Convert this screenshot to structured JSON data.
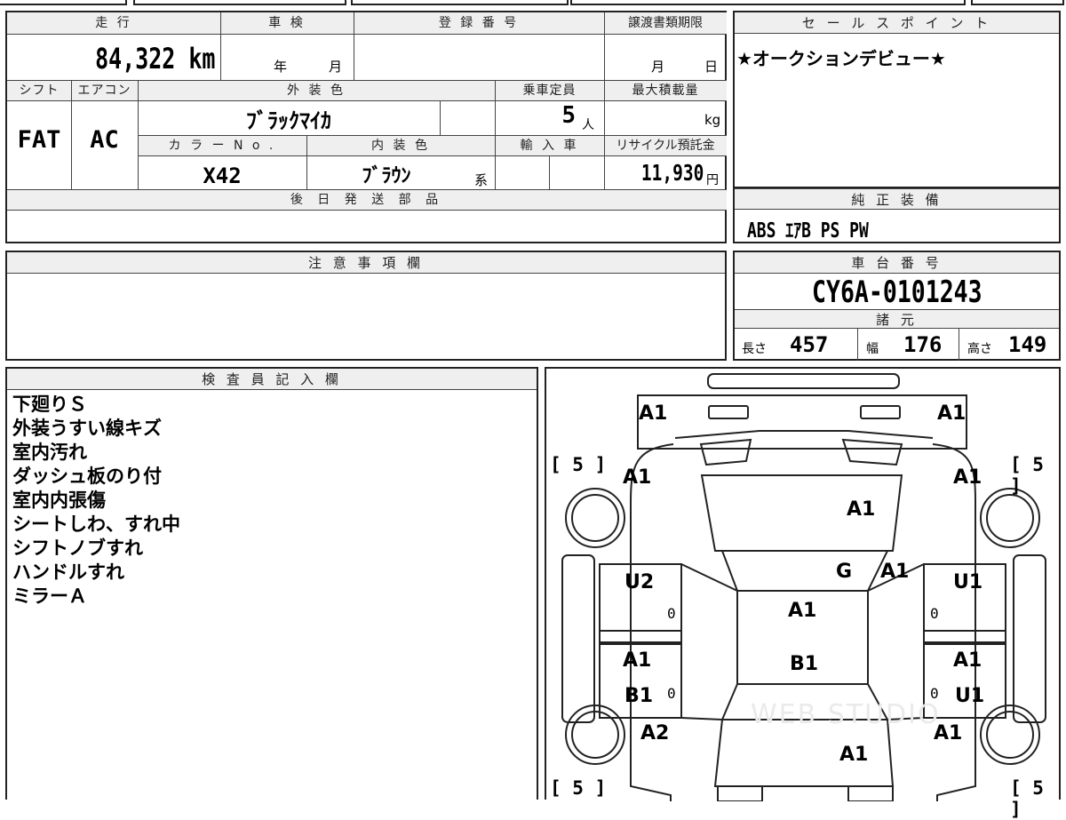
{
  "main_table": {
    "mileage_label": "走 行",
    "mileage_value": "84,322 km",
    "inspection_label": "車 検",
    "inspection_year_unit": "年",
    "inspection_month_unit": "月",
    "registration_label": "登 録 番 号",
    "transfer_label": "譲渡書類期限",
    "transfer_month_unit": "月",
    "transfer_day_unit": "日",
    "shift_label": "シフト",
    "shift_value": "FAT",
    "aircon_label": "エアコン",
    "aircon_value": "AC",
    "exterior_label": "外 装 色",
    "exterior_value": "ﾌﾞﾗｯｸﾏｲｶ",
    "capacity_label": "乗車定員",
    "capacity_value": "5",
    "capacity_unit": "人",
    "max_load_label": "最大積載量",
    "max_load_unit": "kg",
    "color_no_label": "カ ラ ー N o .",
    "color_no_value": "X42",
    "interior_label": "内 装 色",
    "interior_value": "ﾌﾞﾗｳﾝ",
    "interior_suffix": "系",
    "import_label": "輸 入 車",
    "recycle_label": "リサイクル預託金",
    "recycle_value": "11,930",
    "recycle_unit": "円",
    "later_parts_label": "後 日 発 送 部 品"
  },
  "sales_point": {
    "label": "セ ー ル ス ポ イ ン ト",
    "text": "★オークションデビュー★"
  },
  "equipment": {
    "label": "純 正 装 備",
    "text": "ABS ｴｱB PS PW"
  },
  "caution": {
    "label": "注 意 事 項 欄"
  },
  "chassis": {
    "label": "車 台 番 号",
    "value": "CY6A-0101243"
  },
  "specs": {
    "label": "諸 元",
    "length_label": "長さ",
    "length_value": "457",
    "width_label": "幅",
    "width_value": "176",
    "height_label": "高さ",
    "height_value": "149"
  },
  "inspector": {
    "label": "検 査 員 記 入 欄",
    "notes": [
      "下廻りＳ",
      "外装うすい線キズ",
      "室内汚れ",
      "ダッシュ板のり付",
      "室内内張傷",
      "シートしわ、すれ中",
      "シフトノブすれ",
      "ハンドルすれ",
      "ミラーＡ"
    ]
  },
  "diagram": {
    "marks": {
      "front_left": "A1",
      "front_right": "A1",
      "fender_left": "A1",
      "fender_right": "A1",
      "hood": "A1",
      "windshield": "G",
      "windshield_right": "A1",
      "front_door_left": "U2",
      "front_door_right": "U1",
      "roof": "A1",
      "rear_door_left_top": "A1",
      "rear_door_left_bottom": "B1",
      "roof_rear": "B1",
      "rear_door_right_top": "A1",
      "rear_door_right_bottom": "U1",
      "rear_quarter_left": "A2",
      "rear_quarter_right": "A1",
      "trunk": "A1"
    },
    "tire_top_left": "5",
    "tire_top_right": "5",
    "tire_bottom_left": "5",
    "tire_bottom_right": "5",
    "zero": "0",
    "watermark": "WEB STUDIO"
  }
}
